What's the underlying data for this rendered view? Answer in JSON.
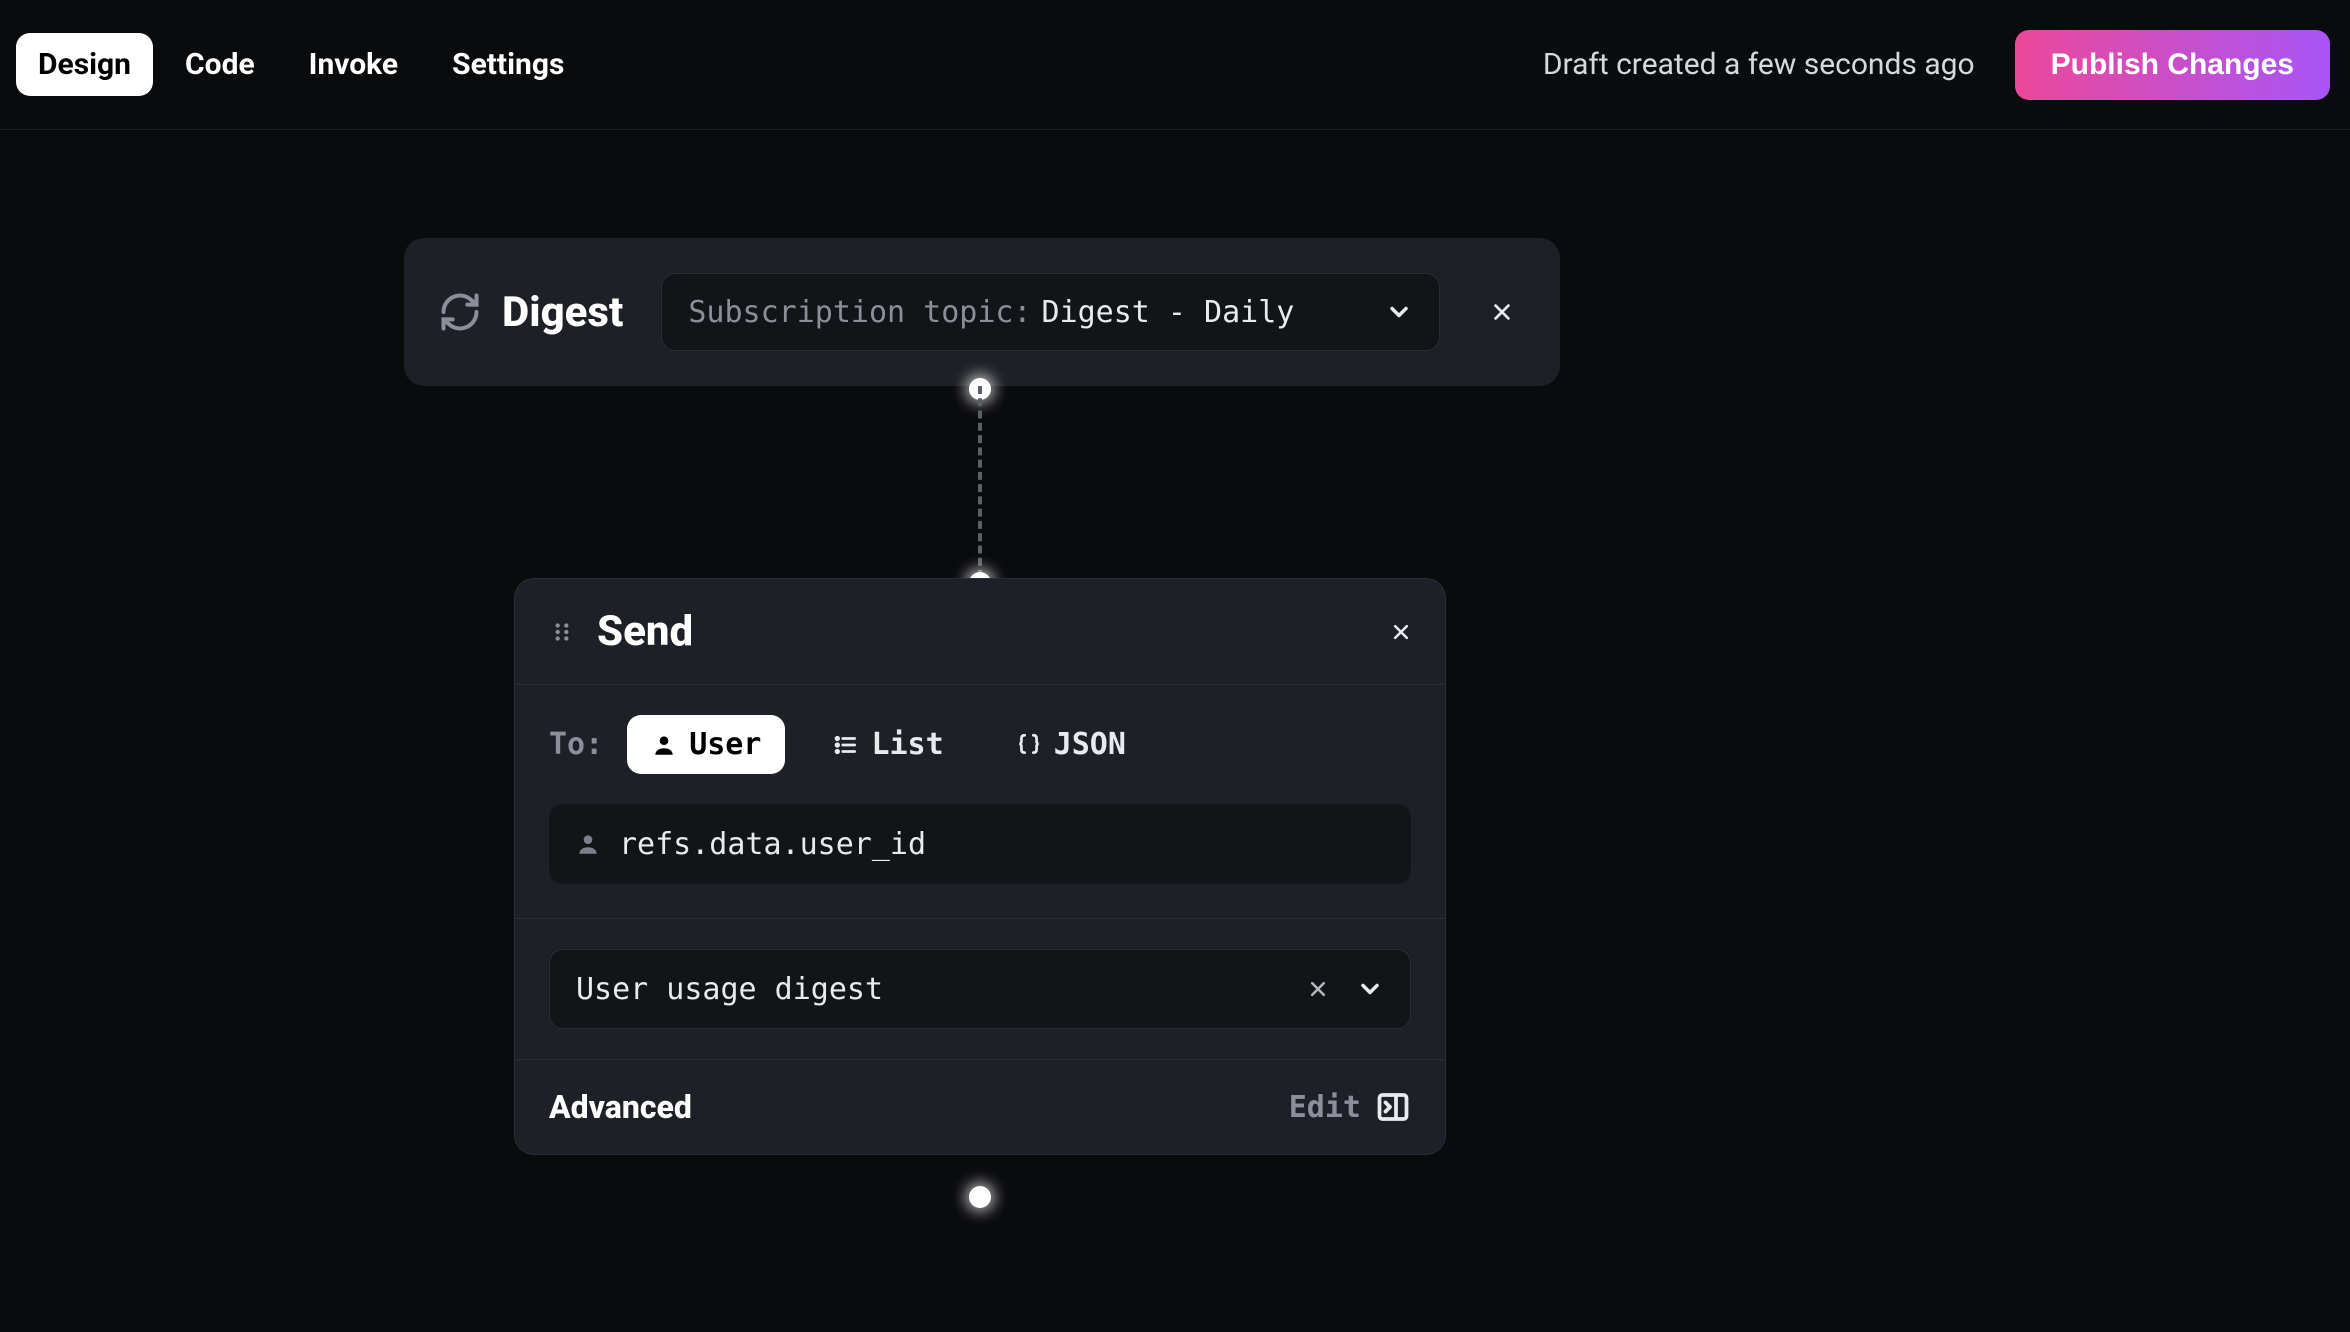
{
  "topbar": {
    "tabs": {
      "design": "Design",
      "code": "Code",
      "invoke": "Invoke",
      "settings": "Settings"
    },
    "draft_status": "Draft created a few seconds ago",
    "publish_label": "Publish Changes"
  },
  "digest": {
    "title": "Digest",
    "topic_label": "Subscription topic:",
    "topic_value": "Digest - Daily"
  },
  "send": {
    "title": "Send",
    "to_label": "To:",
    "recipient_modes": {
      "user": "User",
      "list": "List",
      "json": "JSON"
    },
    "user_field_value": "refs.data.user_id",
    "template_value": "User usage digest",
    "advanced_label": "Advanced",
    "edit_label": "Edit"
  }
}
